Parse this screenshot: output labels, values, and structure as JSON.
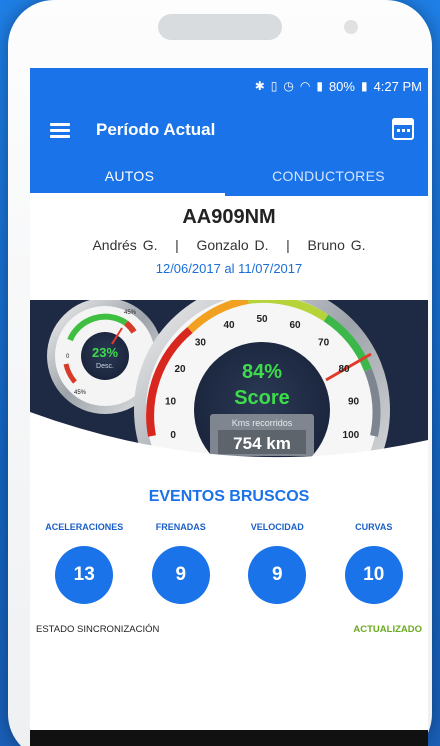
{
  "status": {
    "battery": "80%",
    "time": "4:27 PM"
  },
  "appbar": {
    "title": "Período Actual"
  },
  "tabs": [
    {
      "label": "AUTOS"
    },
    {
      "label": "CONDUCTORES"
    }
  ],
  "vehicle": {
    "plate": "AA909NM",
    "drivers": [
      "Andrés G.",
      "Gonzalo D.",
      "Bruno G."
    ],
    "period": "12/06/2017 al 11/07/2017"
  },
  "small_gauge": {
    "value": "23%",
    "label": "Desc.",
    "ticks": [
      "45%",
      "0",
      "45%"
    ],
    "level_percent": 23
  },
  "main_gauge": {
    "score_value": "84%",
    "score_label": "Score",
    "ticks": [
      "0",
      "10",
      "20",
      "30",
      "40",
      "50",
      "60",
      "70",
      "80",
      "90",
      "100"
    ],
    "km_label": "Kms recorridos",
    "km_value": "754 km",
    "level_percent": 84
  },
  "events": {
    "title": "EVENTOS BRUSCOS",
    "items": [
      {
        "label": "ACELERACIONES",
        "value": "13"
      },
      {
        "label": "FRENADAS",
        "value": "9"
      },
      {
        "label": "VELOCIDAD",
        "value": "9"
      },
      {
        "label": "CURVAS",
        "value": "10"
      }
    ]
  },
  "sync": {
    "label": "ESTADO SINCRONIZACIÓN",
    "status": "ACTUALIZADO"
  },
  "colors": {
    "primary": "#1a73e8",
    "ok": "#6aaa1e",
    "score": "#3ddc4a"
  }
}
